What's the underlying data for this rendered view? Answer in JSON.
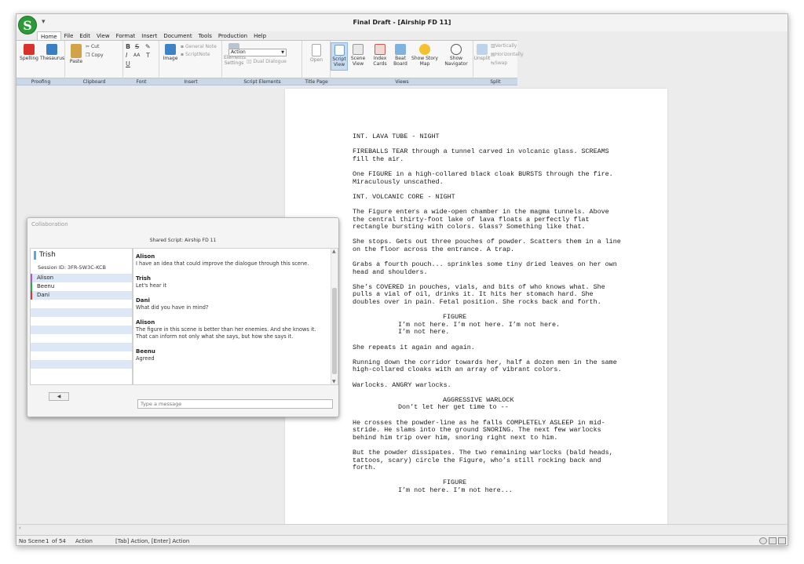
{
  "app": {
    "title": "Final Draft - [Airship FD 11]",
    "logo_letter": "S",
    "quick_access": "▾"
  },
  "menu": {
    "tabs": [
      "Home",
      "File",
      "Edit",
      "View",
      "Format",
      "Insert",
      "Document",
      "Tools",
      "Production",
      "Help"
    ],
    "active": "Home"
  },
  "ribbon": {
    "proofing": {
      "spelling": "Spelling",
      "thesaurus": "Thesaurus",
      "label": "Proofing"
    },
    "clipboard": {
      "paste": "Paste",
      "cut": "Cut",
      "copy": "Copy",
      "label": "Clipboard"
    },
    "font": {
      "bold": "B",
      "strike": "S",
      "italic": "I",
      "aa": "AA",
      "underline": "U",
      "t": "T",
      "label": "Font"
    },
    "insert": {
      "image": "Image",
      "general_note": "General Note",
      "script_note": "ScriptNote",
      "label": "Insert"
    },
    "script_elements": {
      "elements_settings_1": "Elements",
      "elements_settings_2": "Settings",
      "element_value": "Action",
      "dual_dialogue": "Dual Dialogue",
      "label": "Script Elements"
    },
    "title_page": {
      "open": "Open",
      "label": "Title Page"
    },
    "views": {
      "script": "Script",
      "script_sub": "View",
      "scene": "Scene",
      "scene_sub": "View",
      "index": "Index",
      "index_sub": "Cards",
      "beat": "Beat",
      "beat_sub": "Board",
      "story_map_1": "Show Story",
      "story_map_2": "Map",
      "navigator_1": "Show",
      "navigator_2": "Navigator",
      "label": "Views"
    },
    "split": {
      "unsplit": "Unsplit",
      "vertically": "Vertically",
      "horizontally": "Horizontally",
      "swap": "Swap",
      "label": "Split"
    }
  },
  "script": {
    "elements": [
      {
        "type": "scene",
        "text": "INT. LAVA TUBE - NIGHT"
      },
      {
        "type": "action",
        "text": "FIREBALLS TEAR through a tunnel carved in volcanic glass. SCREAMS fill the air."
      },
      {
        "type": "action",
        "text": "One FIGURE in a high-collared black cloak BURSTS through the fire. Miraculously unscathed."
      },
      {
        "type": "scene",
        "text": "INT. VOLCANIC CORE - NIGHT"
      },
      {
        "type": "action",
        "text": "The Figure enters a wide-open chamber in the magma tunnels. Above the central thirty-foot lake of lava floats a perfectly flat rectangle bursting with colors. Glass? Something like that."
      },
      {
        "type": "action",
        "text": "She stops. Gets out three pouches of powder. Scatters them in a line on the floor across the entrance. A trap."
      },
      {
        "type": "action",
        "text": "Grabs a fourth pouch... sprinkles some tiny dried leaves on her own head and shoulders."
      },
      {
        "type": "action",
        "text": "She’s COVERED in pouches, vials, and bits of who knows what. She pulls a vial of oil, drinks it. It hits her stomach hard. She doubles over in pain. Fetal position. She rocks back and forth."
      },
      {
        "type": "character",
        "text": "FIGURE"
      },
      {
        "type": "dialogue",
        "text": "I’m not here. I’m not here. I’m not here. I’m not here."
      },
      {
        "type": "action",
        "text": "She repeats it again and again."
      },
      {
        "type": "action",
        "text": "Running down the corridor towards her, half a dozen men in the same high-collared cloaks with an array of vibrant colors."
      },
      {
        "type": "action",
        "text": "Warlocks. ANGRY warlocks."
      },
      {
        "type": "character",
        "text": "AGGRESSIVE WARLOCK"
      },
      {
        "type": "dialogue",
        "text": "Don’t let her get time to --"
      },
      {
        "type": "action",
        "text": "He crosses the powder-line as he falls COMPLETELY ASLEEP in mid-stride. He slams into the ground SNORING. The next few warlocks behind him trip over him, snoring right next to him."
      },
      {
        "type": "action",
        "text": "But the powder dissipates. The two remaining warlocks (bald heads, tattoos, scary) circle the Figure, who’s still rocking back and forth."
      },
      {
        "type": "character",
        "text": "FIGURE"
      },
      {
        "type": "dialogue",
        "text": "I’m not here. I’m not here..."
      }
    ]
  },
  "collaboration": {
    "title": "Collaboration",
    "shared_script": "Shared Script: Airship FD 11",
    "user": "Trish",
    "session": "Session ID: 3FR-5W3C-KCB",
    "participants": [
      "Alison",
      "Beenu",
      "Dani"
    ],
    "mute_icon": "◀",
    "messages": [
      {
        "author": "Alison",
        "text": "I have an idea that could improve the dialogue through this scene."
      },
      {
        "author": "Trish",
        "text": "Let's hear it"
      },
      {
        "author": "Dani",
        "text": "What did you have in mind?"
      },
      {
        "author": "Alison",
        "text": "The figure in this scene is better than her enemies. And she knows it. That can inform not only what she says, but how she says it."
      },
      {
        "author": "Beenu",
        "text": "Agreed"
      }
    ],
    "input_placeholder": "Type a message"
  },
  "status": {
    "scene": "No Scene",
    "page": "1",
    "of": "of 54",
    "element": "Action",
    "hint": "[Tab] Action, [Enter] Action"
  },
  "colors": {
    "ribbon_footer": "#c9d7e6",
    "accent_blue": "#5aa8e0",
    "app_green": "#2d9a3a"
  }
}
